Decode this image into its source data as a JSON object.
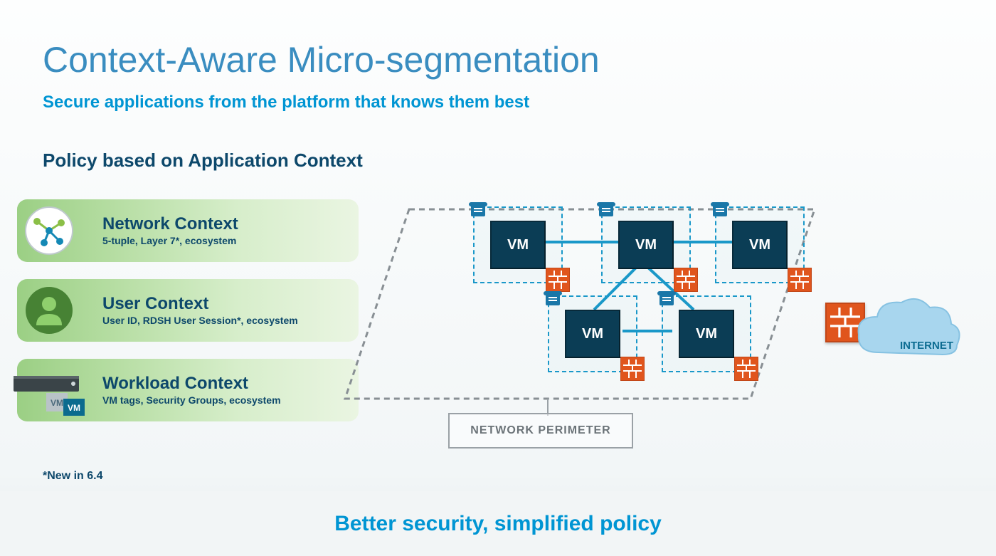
{
  "title": "Context-Aware Micro-segmentation",
  "subtitle": "Secure applications from the platform that knows them best",
  "section_heading": "Policy based on Application Context",
  "cards": {
    "network": {
      "title": "Network Context",
      "sub": "5-tuple, Layer 7*, ecosystem"
    },
    "user": {
      "title": "User Context",
      "sub": "User ID, RDSH User Session*, ecosystem"
    },
    "workload": {
      "title": "Workload Context",
      "sub": "VM tags, Security Groups, ecosystem"
    }
  },
  "footnote": "*New in 6.4",
  "bottom_text": "Better security, simplified policy",
  "diagram": {
    "vm_label": "VM",
    "perimeter_label": "NETWORK PERIMETER",
    "internet_label": "INTERNET"
  }
}
